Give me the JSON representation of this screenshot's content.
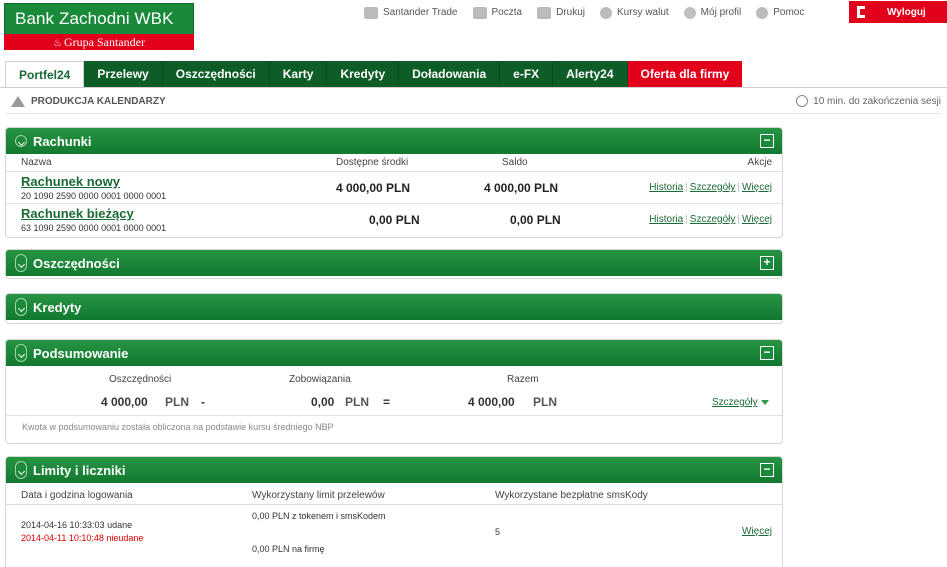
{
  "brand": {
    "name": "Bank Zachodni WBK",
    "group": "Grupa Santander"
  },
  "topnav": [
    {
      "label": "Santander Trade",
      "icon": "handshake-icon"
    },
    {
      "label": "Poczta",
      "icon": "mail-icon"
    },
    {
      "label": "Drukuj",
      "icon": "printer-icon"
    },
    {
      "label": "Kursy walut",
      "icon": "currency-icon"
    },
    {
      "label": "Mój profil",
      "icon": "gear-icon"
    },
    {
      "label": "Pomoc",
      "icon": "help-icon"
    }
  ],
  "logout": "Wyloguj",
  "tabs": [
    "Portfel24",
    "Przelewy",
    "Oszczędności",
    "Karty",
    "Kredyty",
    "Doładowania",
    "e-FX",
    "Alerty24",
    "Oferta dla firmy"
  ],
  "company": "PRODUKCJA KALENDARZY",
  "session": "10 min. do zakończenia sesji",
  "accounts": {
    "title": "Rachunki",
    "toggle": "−",
    "headers": {
      "name": "Nazwa",
      "available": "Dostępne środki",
      "balance": "Saldo",
      "actions": "Akcje"
    },
    "rows": [
      {
        "name": "Rachunek nowy",
        "number": "20 1090 2590 0000 0001 0000 0001",
        "available": "4 000,00  PLN",
        "balance": "4 000,00  PLN"
      },
      {
        "name": "Rachunek bieżący",
        "number": "63 1090 2590 0000 0001  0000 0001",
        "available": "0,00  PLN",
        "balance": "0,00  PLN"
      }
    ],
    "actions": [
      "Historia",
      "Szczegóły",
      "Więcej"
    ]
  },
  "savings": {
    "title": "Oszczędności",
    "toggle": "+"
  },
  "credits": {
    "title": "Kredyty"
  },
  "summary": {
    "title": "Podsumowanie",
    "toggle": "−",
    "labels": {
      "savings": "Oszczędności",
      "liabilities": "Zobowiązania",
      "total": "Razem"
    },
    "savings_amount": "4 000,00",
    "liabilities_amount": "0,00",
    "total_amount": "4 000,00",
    "currency": "PLN",
    "minus": "-",
    "equals": "=",
    "details": "Szczegóły",
    "note": "Kwota w podsumowaniu została obliczona na podstawie kursu średniego NBP"
  },
  "limits": {
    "title": "Limity i liczniki",
    "toggle": "−",
    "headers": {
      "login": "Data i godzina logowania",
      "transfer_limit": "Wykorzystany limit przelewów",
      "sms": "Wykorzystane bezpłatne smsKody"
    },
    "login_ok": "2014-04-16 10:33:03 udane",
    "login_fail": "2014-04-11 10:10:48 nieudane",
    "limit_token": "0,00 PLN z tokenem i smsKodem",
    "limit_company": "0,00 PLN na firmę",
    "sms_count": "5",
    "more": "Więcej"
  },
  "colors": {
    "green": "#127a30",
    "dark_green": "#0e5d27",
    "red": "#e3001b"
  }
}
